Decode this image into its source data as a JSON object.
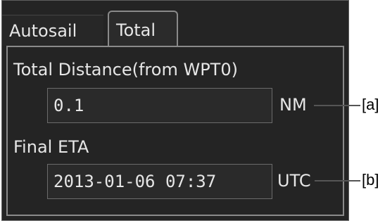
{
  "tabs": [
    {
      "label": "Autosail",
      "active": false
    },
    {
      "label": "Total",
      "active": true
    }
  ],
  "total_distance": {
    "label": "Total Distance(from WPT0)",
    "value": "0.1",
    "unit": "NM",
    "callout": "[a]"
  },
  "final_eta": {
    "label": "Final ETA",
    "value": "2013-01-06 07:37",
    "unit": "UTC",
    "callout": "[b]"
  },
  "colors": {
    "panel_bg": "#242424",
    "text": "#e6e6e6",
    "border": "#8a8a8a"
  }
}
